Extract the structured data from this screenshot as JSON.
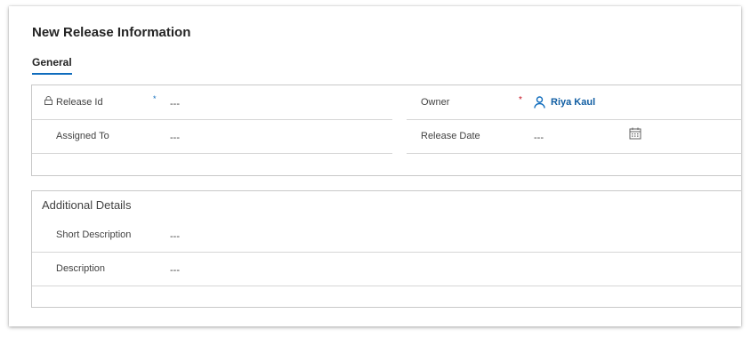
{
  "form": {
    "title": "New Release Information",
    "tabs": [
      {
        "label": "General",
        "selected": true
      }
    ]
  },
  "general": {
    "release_id": {
      "label": "Release Id",
      "value": "---",
      "required": "*",
      "locked": true
    },
    "assigned_to": {
      "label": "Assigned To",
      "value": "---"
    },
    "owner": {
      "label": "Owner",
      "required": "*",
      "value": "Riya Kaul",
      "icon": "person-icon"
    },
    "release_date": {
      "label": "Release Date",
      "value": "---",
      "icon": "calendar-icon"
    }
  },
  "additional": {
    "heading": "Additional Details",
    "short_description": {
      "label": "Short Description",
      "value": "---"
    },
    "description": {
      "label": "Description",
      "value": "---"
    }
  },
  "colors": {
    "accent": "#0f6cbd",
    "link": "#115ea3",
    "required_red": "#c50f1f",
    "required_blue": "#0f6cbd"
  }
}
